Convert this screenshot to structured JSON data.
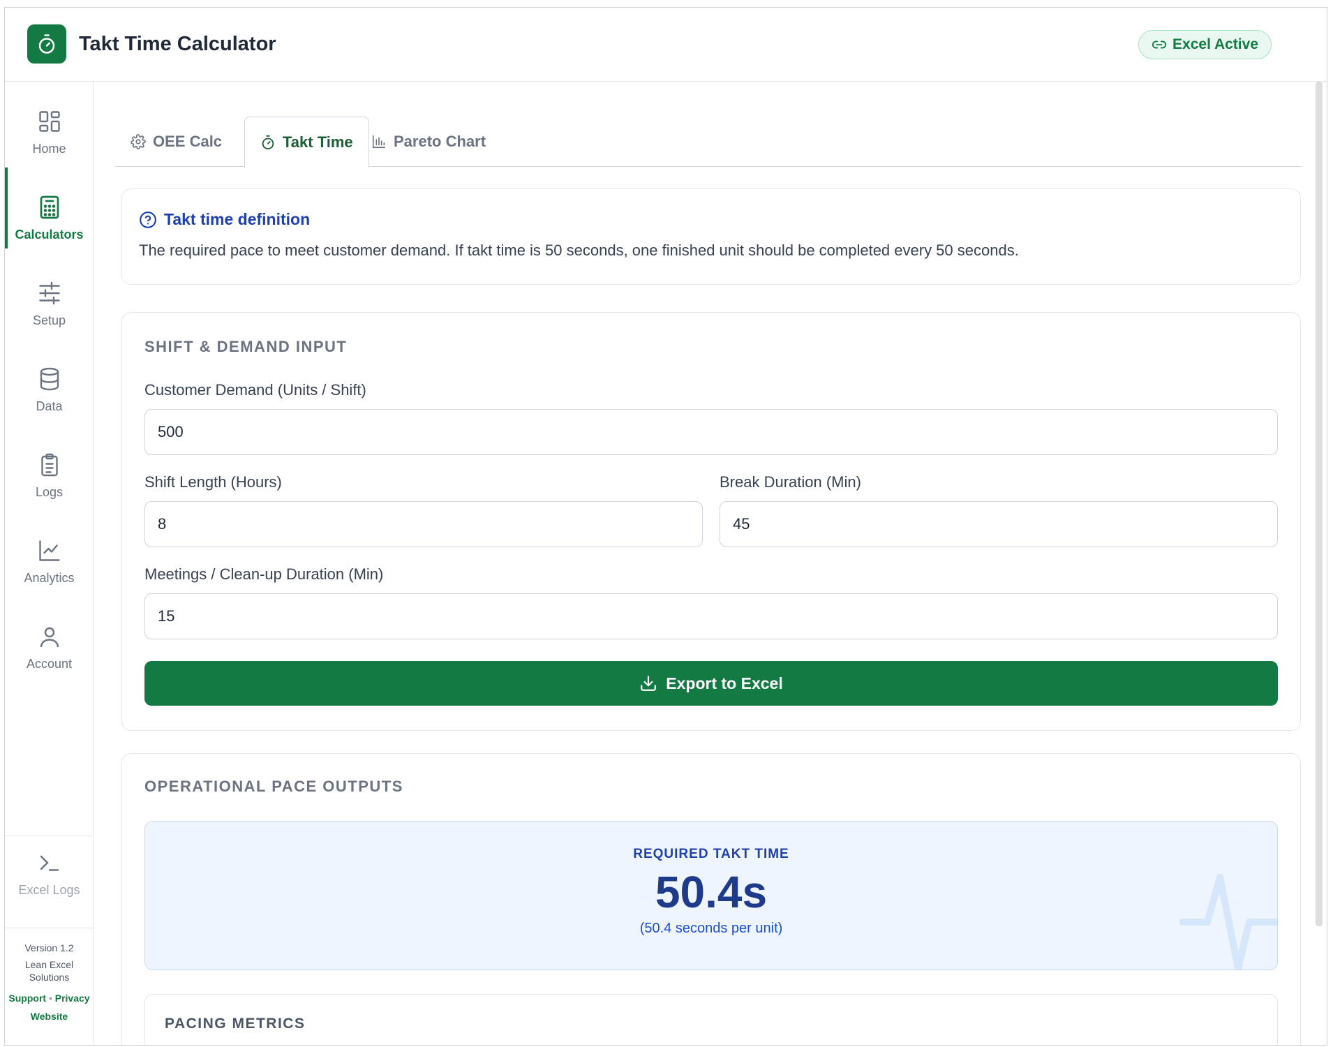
{
  "header": {
    "app_title": "Takt Time Calculator",
    "excel_status": "Excel Active",
    "logo_icon": "stopwatch-icon"
  },
  "sidebar": {
    "items": [
      {
        "label": "Home",
        "icon": "grid-icon",
        "active": false
      },
      {
        "label": "Calculators",
        "icon": "calculator-icon",
        "active": true
      },
      {
        "label": "Setup",
        "icon": "sliders-icon",
        "active": false
      },
      {
        "label": "Data",
        "icon": "database-icon",
        "active": false
      },
      {
        "label": "Logs",
        "icon": "clipboard-icon",
        "active": false
      },
      {
        "label": "Analytics",
        "icon": "line-chart-icon",
        "active": false
      },
      {
        "label": "Account",
        "icon": "user-icon",
        "active": false
      }
    ],
    "excel_logs": "Excel Logs",
    "version": "Version 1.2",
    "company": "Lean Excel Solutions",
    "link_support": "Support",
    "link_sep": "•",
    "link_privacy": "Privacy",
    "link_website": "Website"
  },
  "tabs": [
    {
      "label": "OEE Calc",
      "icon": "gear-icon"
    },
    {
      "label": "Takt Time",
      "icon": "stopwatch-icon",
      "active": true
    },
    {
      "label": "Pareto Chart",
      "icon": "bar-chart-icon"
    }
  ],
  "info": {
    "title": "Takt time definition",
    "text": "The required pace to meet customer demand. If takt time is 50 seconds, one finished unit should be completed every 50 seconds."
  },
  "input_section": {
    "title": "SHIFT & DEMAND INPUT",
    "demand_label": "Customer Demand (Units / Shift)",
    "demand_value": "500",
    "shift_label": "Shift Length (Hours)",
    "shift_value": "8",
    "break_label": "Break Duration (Min)",
    "break_value": "45",
    "meetings_label": "Meetings / Clean-up Duration (Min)",
    "meetings_value": "15",
    "export_label": "Export to Excel"
  },
  "output_section": {
    "title": "OPERATIONAL PACE OUTPUTS",
    "takt_label": "REQUIRED TAKT TIME",
    "takt_value": "50.4s",
    "takt_sub": "(50.4 seconds per unit)",
    "metrics_title": "PACING METRICS"
  },
  "colors": {
    "brand": "#147a43",
    "info_blue": "#1e40af",
    "takt_bg": "#eef5fe"
  }
}
